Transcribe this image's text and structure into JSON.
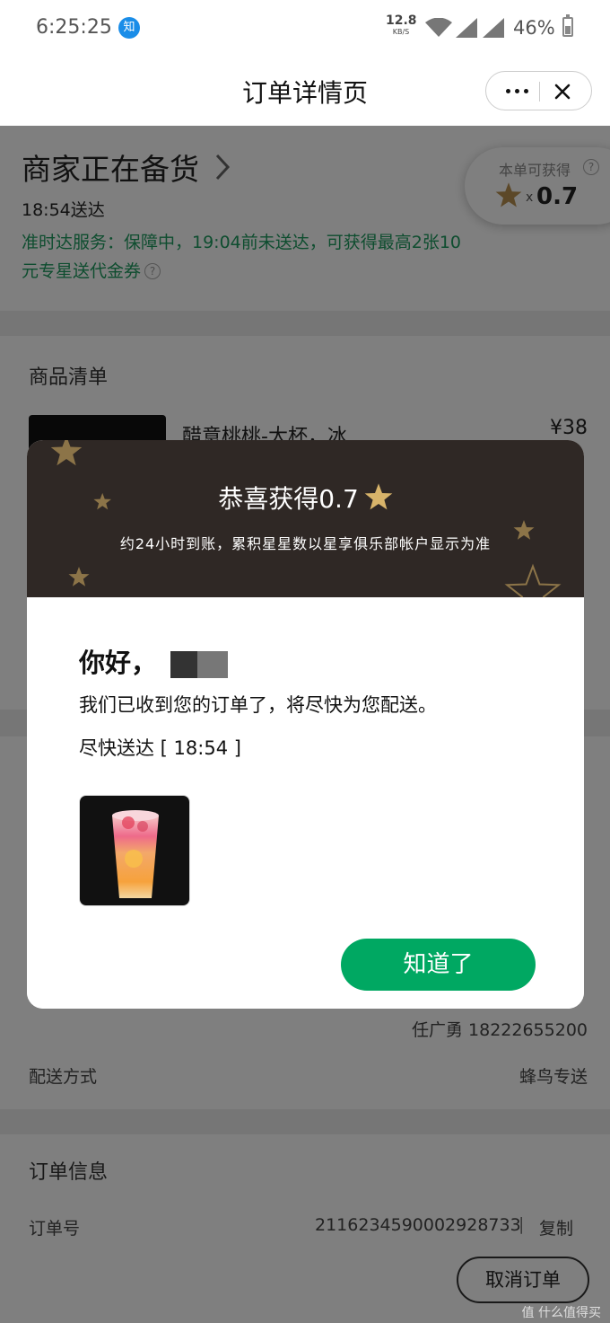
{
  "status_bar": {
    "time": "6:25:25",
    "app_badge": "知",
    "net_speed_value": "12.8",
    "net_speed_unit": "KB/S",
    "battery": "46%"
  },
  "nav": {
    "title": "订单详情页"
  },
  "order_status": {
    "title": "商家正在备货",
    "delivery_time": "18:54送达",
    "guarantee": "准时达服务：保障中，19:04前未送达，可获得最高2张10元专星送代金券"
  },
  "stars_panel": {
    "label": "本单可获得",
    "multiplier": "x",
    "value": "0.7"
  },
  "goods": {
    "title": "商品清单",
    "item_name": "醋意桃桃-大杯，冰",
    "item_price": "¥38"
  },
  "delivery": {
    "contact": "任广勇 18222655200",
    "method_label": "配送方式",
    "method_value": "蜂鸟专送"
  },
  "order_info": {
    "title": "订单信息",
    "order_no_label": "订单号",
    "order_no": "2116234590002928733",
    "separator": "|",
    "copy_label": "复制",
    "cancel_label": "取消订单"
  },
  "modal": {
    "title": "恭喜获得0.7",
    "subtitle": "约24小时到账，累积星星数以星享俱乐部帐户显示为准",
    "greeting": "你好，",
    "message": "我们已收到您的订单了，将尽快为您配送。",
    "eta": "尽快送达 [ 18:54 ]",
    "ok_label": "知道了"
  },
  "watermark": "值 什么值得买",
  "colors": {
    "accent_green": "#00a862",
    "guarantee_green": "#1d9a5e",
    "modal_header": "#2f2825",
    "star_gold": "#d8b46a"
  }
}
